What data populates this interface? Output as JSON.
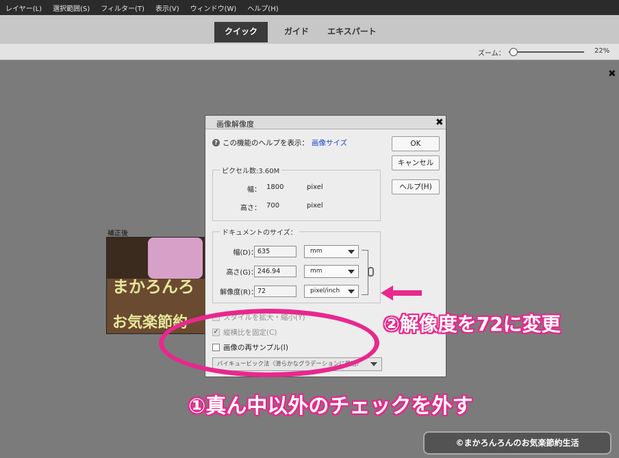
{
  "menubar": {
    "items": [
      "レイヤー(L)",
      "選択範囲(S)",
      "フィルター(T)",
      "表示(V)",
      "ウィンドウ(W)",
      "ヘルプ(H)"
    ]
  },
  "modes": {
    "tabs": [
      "クイック",
      "ガイド",
      "エキスパート"
    ],
    "active": "クイック"
  },
  "zoom": {
    "label": "ズーム：",
    "value_text": "22%",
    "level_percent": 22
  },
  "preview": {
    "label": "補正後",
    "text_line1": "まかろんろ",
    "text_line2": "お気楽節約"
  },
  "dialog": {
    "title": "画像解像度",
    "help_prefix": "この機能のヘルプを表示：",
    "help_link": "画像サイズ",
    "ok_label": "OK",
    "cancel_label": "キャンセル",
    "help_button_label": "ヘルプ(H)",
    "pixel_group": {
      "title": "ピクセル数:3.60M",
      "width_label": "幅：",
      "width_value": "1800",
      "width_unit": "pixel",
      "height_label": "高さ：",
      "height_value": "700",
      "height_unit": "pixel"
    },
    "doc_group": {
      "title": "ドキュメントのサイズ：",
      "width_label": "幅(D)：",
      "width_value": "635",
      "width_unit": "mm",
      "height_label": "高さ(G)：",
      "height_value": "246.94",
      "height_unit": "mm",
      "resolution_label": "解像度(R)：",
      "resolution_value": "72",
      "resolution_unit": "pixel/inch"
    },
    "options": {
      "scale_styles": "スタイルを拡大・縮小(Y)",
      "constrain": "縦横比を固定(C)",
      "resample": "画像の再サンプル(I)"
    },
    "resample_method": "バイキュービック法（滑らかなグラデーションに最適）"
  },
  "annotations": {
    "step2": "②解像度を72に変更",
    "step1": "①真ん中以外のチェックを外す",
    "credit": "©まかろんろんのお気楽節約生活"
  },
  "colors": {
    "accent": "#e8288d",
    "link": "#1e48c8"
  }
}
